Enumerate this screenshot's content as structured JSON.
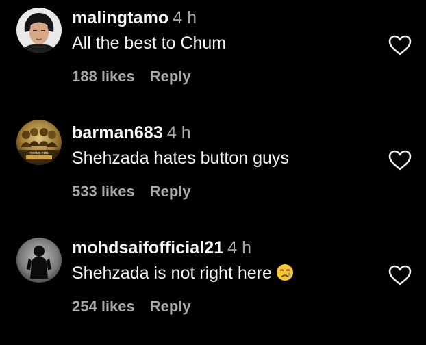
{
  "comments": [
    {
      "username": "malingtamo",
      "time": "4 h",
      "text": "All the best to Chum",
      "likes": "188 likes",
      "reply": "Reply",
      "avatar_icon": "person-photo-avatar",
      "emoji": ""
    },
    {
      "username": "barman683",
      "time": "4 h",
      "text": "Shehzada hates button guys",
      "likes": "533 likes",
      "reply": "Reply",
      "avatar_icon": "poster-photo-avatar",
      "avatar_poster_text": "THANK YOU",
      "emoji": ""
    },
    {
      "username": "mohdsaifofficial21",
      "time": "4 h",
      "text": "Shehzada is not right here",
      "likes": "254 likes",
      "reply": "Reply",
      "avatar_icon": "silhouette-avatar",
      "emoji": "crying-face-emoji"
    }
  ],
  "colors": {
    "background": "#000000",
    "primary_text": "#f5f5f5",
    "secondary_text": "#a8a8a8",
    "heart_outline": "#f5f5f5"
  }
}
